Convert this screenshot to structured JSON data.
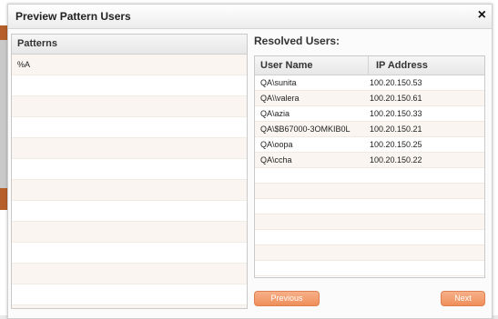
{
  "dialog": {
    "title": "Preview Pattern Users",
    "close_label": "×"
  },
  "patterns": {
    "header": "Patterns",
    "rows": [
      "%A",
      "",
      "",
      "",
      "",
      "",
      "",
      "",
      "",
      "",
      "",
      "",
      ""
    ]
  },
  "users": {
    "label": "Resolved Users:",
    "columns": [
      "User Name",
      "IP Address"
    ],
    "rows": [
      {
        "name": "QA\\sunita",
        "ip": "100.20.150.53"
      },
      {
        "name": "QA\\\\valera",
        "ip": "100.20.150.61"
      },
      {
        "name": "QA\\azia",
        "ip": "100.20.150.33"
      },
      {
        "name": "QA\\$B67000-3OMKIB0L",
        "ip": "100.20.150.21"
      },
      {
        "name": "QA\\oopa",
        "ip": "100.20.150.25"
      },
      {
        "name": "QA\\ccha",
        "ip": "100.20.150.22"
      },
      {
        "name": "",
        "ip": ""
      },
      {
        "name": "",
        "ip": ""
      },
      {
        "name": "",
        "ip": ""
      },
      {
        "name": "",
        "ip": ""
      },
      {
        "name": "",
        "ip": ""
      },
      {
        "name": "",
        "ip": ""
      },
      {
        "name": "",
        "ip": ""
      }
    ]
  },
  "buttons": {
    "previous": "Previous",
    "next": "Next"
  },
  "colors": {
    "button_accent": "#ef8f5a",
    "row_alt": "#faf5f0"
  }
}
